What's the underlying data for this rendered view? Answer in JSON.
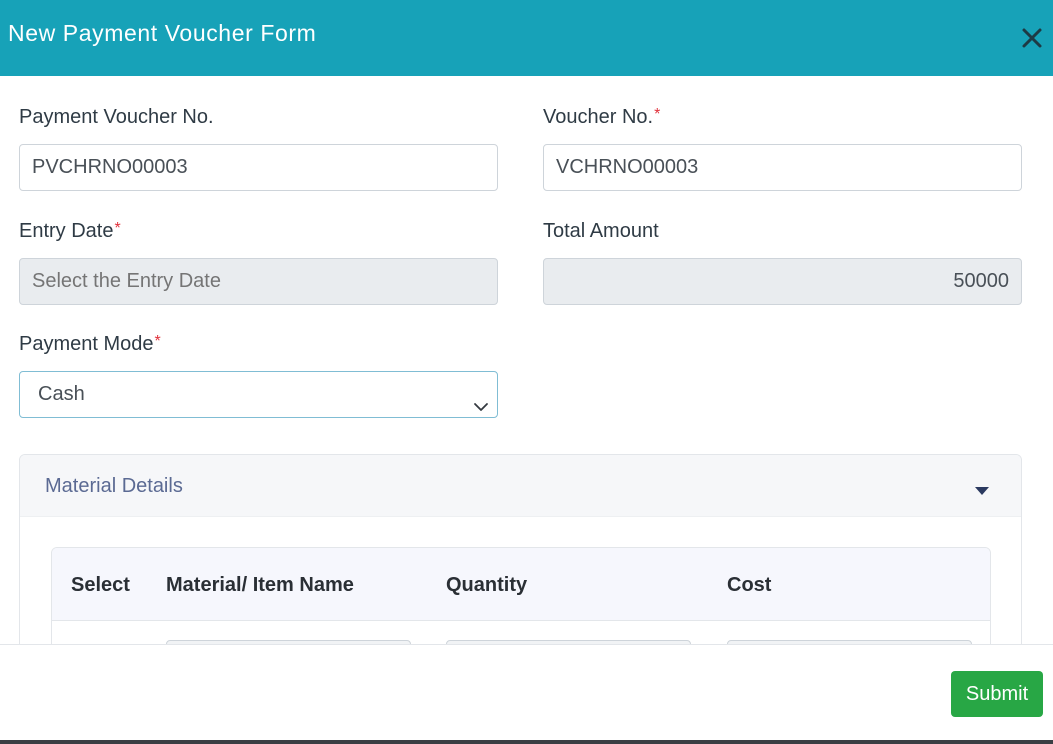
{
  "modal": {
    "title": "New Payment Voucher Form",
    "close_icon": "close-icon"
  },
  "form": {
    "payment_voucher_no": {
      "label": "Payment Voucher No.",
      "value": "PVCHRNO00003"
    },
    "voucher_no": {
      "label": "Voucher No.",
      "required_mark": "*",
      "value": "VCHRNO00003"
    },
    "entry_date": {
      "label": "Entry Date",
      "required_mark": "*",
      "placeholder": "Select the Entry Date"
    },
    "total_amount": {
      "label": "Total Amount",
      "value": "50000"
    },
    "payment_mode": {
      "label": "Payment Mode",
      "required_mark": "*",
      "selected": "Cash"
    }
  },
  "material_details": {
    "title": "Material Details",
    "columns": [
      "Select",
      "Material/ Item Name",
      "Quantity",
      "Cost"
    ]
  },
  "footer": {
    "submit_label": "Submit"
  },
  "colors": {
    "header_bg": "#17a2b8",
    "submit_bg": "#28a745",
    "required": "#e0303a"
  }
}
